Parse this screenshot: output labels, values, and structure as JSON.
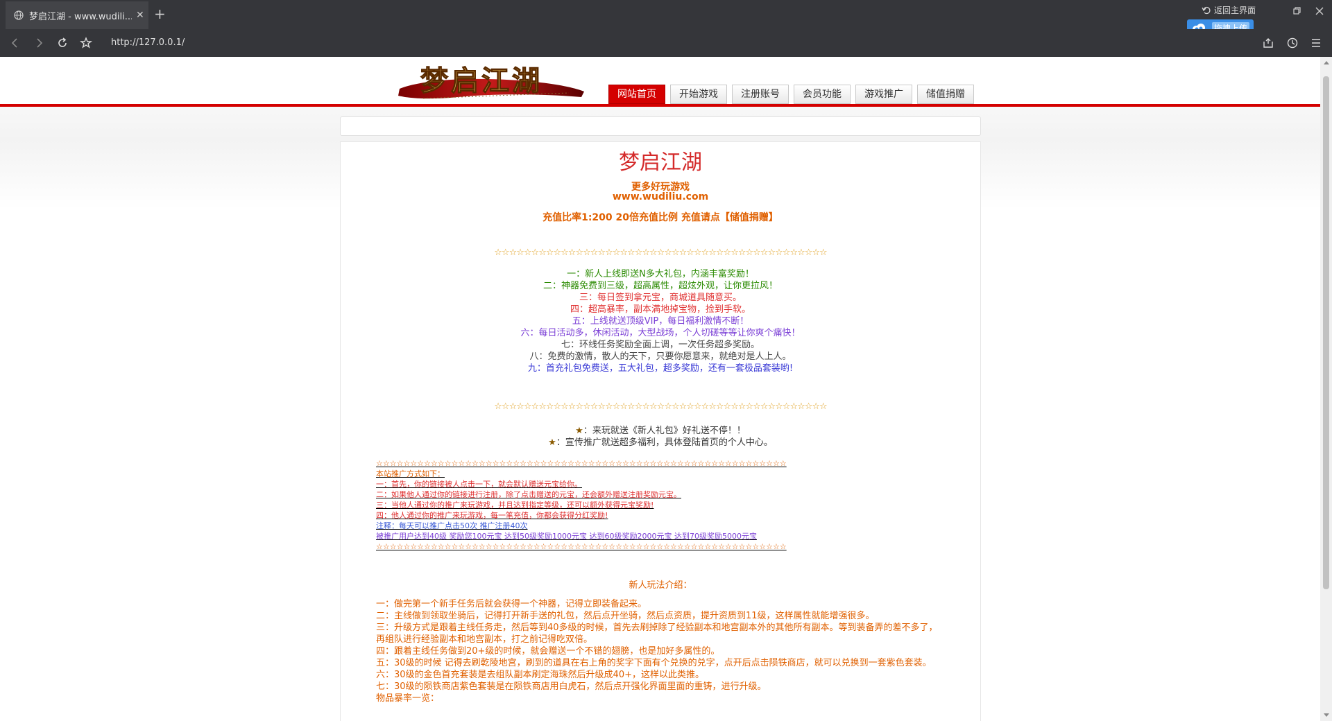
{
  "browser": {
    "tab_title": "梦启江湖 - www.wudili...",
    "tab_close": "✕",
    "new_tab": "+",
    "url": "http://127.0.0.1/",
    "home_label": "返回主界面",
    "upload_label": "拖拽上传"
  },
  "header": {
    "logo_text": "梦启江湖",
    "nav": [
      {
        "label": "网站首页",
        "active": true
      },
      {
        "label": "开始游戏"
      },
      {
        "label": "注册账号"
      },
      {
        "label": "会员功能"
      },
      {
        "label": "游戏推广"
      },
      {
        "label": "储值捐赠"
      }
    ]
  },
  "main": {
    "title": "梦启江湖",
    "subtitle": "更多好玩游戏",
    "site_url": "www.wudiliu.com",
    "ratio": "充值比率1:200 20倍充值比例 充值请点【储值捐赠】",
    "stars_line": "☆☆☆☆☆☆☆☆☆☆☆☆☆☆☆☆☆☆☆☆☆☆☆☆☆☆☆☆☆☆☆☆☆☆☆☆☆☆☆☆☆☆☆☆☆",
    "features": [
      {
        "text": "一：新人上线即送N多大礼包，内涵丰富奖励！",
        "color": "#2a8a00"
      },
      {
        "text": "二：神器免费到三级，超高属性，超炫外观，让你更拉风！",
        "color": "#2a8a00"
      },
      {
        "text": "三：每日签到拿元宝，商城道具随意买。",
        "color": "#e03030"
      },
      {
        "text": "四：超高暴率，副本满地掉宝物，捡到手软。",
        "color": "#e03030"
      },
      {
        "text": "五：上线就送顶级VIP，每日福利激情不断！",
        "color": "#7b3fd6"
      },
      {
        "text": "六：每日活动多，休闲活动，大型战场，个人切磋等等让你爽个痛快！",
        "color": "#7b3fd6"
      },
      {
        "text": "七：环线任务奖励全面上调，一次任务超多奖励。",
        "color": "#444444"
      },
      {
        "text": "八：免费的激情，散人的天下，只要你愿意来，就绝对是人上人。",
        "color": "#444444"
      },
      {
        "text": "九：首充礼包免费送，五大礼包，超多奖励，还有一套极品套装哟!",
        "color": "#3a3ad6"
      }
    ],
    "promo_lines": [
      {
        "star": "★",
        "text": "：来玩就送《新人礼包》好礼送不停！！"
      },
      {
        "star": "★",
        "text": "：宣传推广就送超多福利，具体登陆首页的个人中心。"
      }
    ],
    "howto_stars": "☆☆☆☆☆☆☆☆☆☆☆☆☆☆☆☆☆☆☆☆☆☆☆☆☆☆☆☆☆☆☆☆☆☆☆☆☆☆☆☆☆☆☆☆☆☆☆☆☆☆☆☆☆☆☆☆☆☆☆☆",
    "howto": [
      {
        "text": "本站推广方式如下：",
        "color": "#e06000"
      },
      {
        "text": "一：首先，你的链接被人点击一下，就会默认赠送元宝给你。",
        "color": "#e03030"
      },
      {
        "text": "二：如果他人通过你的链接进行注册，除了点击赠送的元宝，还会额外赠送注册奖励元宝。",
        "color": "#e03030"
      },
      {
        "text": "三：当他人通过你的推广来玩游戏，并且达到指定等级，还可以额外获得元宝奖励!",
        "color": "#e03030"
      },
      {
        "text": "四：他人通过你的推广来玩游戏，每一笔充值，你都会获得分红奖励!",
        "color": "#e03030"
      },
      {
        "text": "注释：每天可以推广点击50次 推广注册40次",
        "color": "#3a5ad6"
      },
      {
        "text": "被推广用户达到40级 奖励您100元宝 达到50级奖励1000元宝 达到60级奖励2000元宝 达到70级奖励5000元宝",
        "color": "#7b3fd6"
      }
    ],
    "play_title": "新人玩法介绍：",
    "play": [
      "一：做完第一个新手任务后就会获得一个神器，记得立即装备起来。",
      "二：主线做到领取坐骑后，记得打开新手送的礼包，然后点开坐骑，然后点资质，提升资质到11级，这样属性就能增强很多。",
      "三：升级方式是跟着主线任务走，然后等到40多级的时候，首先去刷掉除了经验副本和地宫副本外的其他所有副本。等到装备弄的差不多了，再组队进行经验副本和地宫副本，打之前记得吃双倍。",
      "四：跟着主线任务做到20+级的时候，就会赠送一个不错的翅膀，也是加好多属性的。",
      "五：30级的时候 记得去刷乾陵地宫，刷到的道具在右上角的奖字下面有个兑换的兑字，点开后点击陨铁商店，就可以兑换到一套紫色套装。",
      "六：30级的金色首充套装是去组队副本刷定海珠然后升级成40+，这样以此类推。",
      "七：30级的陨铁商店紫色套装是在陨铁商店用白虎石，然后点开强化界面里面的重铸，进行升级。",
      "物品暴率一览："
    ]
  }
}
